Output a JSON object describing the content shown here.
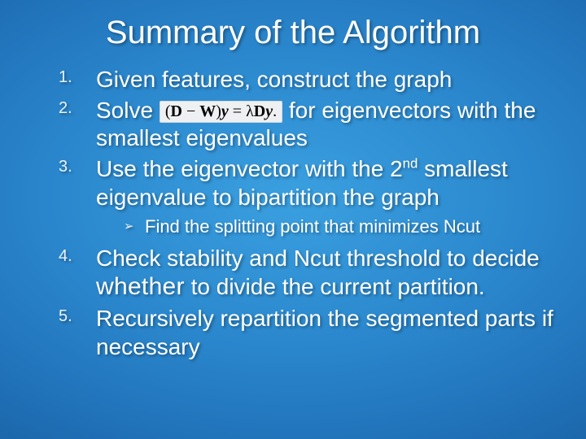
{
  "title": "Summary of the Algorithm",
  "items": [
    {
      "num": "1.",
      "text": "Given features, construct the graph"
    },
    {
      "num": "2.",
      "pre": "Solve ",
      "eqn": {
        "D": "D",
        "W": "W",
        "y": "y",
        "eq": " = ",
        "lam": "λ"
      },
      "post": " for eigenvectors with the smallest eigenvalues"
    },
    {
      "num": "3.",
      "text_a": "Use the eigenvector with the 2",
      "sup": "nd",
      "text_b": " smallest eigenvalue to bipartition the graph",
      "sub": [
        {
          "bullet": "➢",
          "text": "Find the splitting point that minimizes Ncut"
        }
      ]
    },
    {
      "num": "4.",
      "text_a": "Check stability and Ncut threshold to decide ",
      "whether": "whether",
      "text_b": " to divide the current partition."
    },
    {
      "num": "5.",
      "text": "Recursively repartition the segmented parts if necessary"
    }
  ]
}
